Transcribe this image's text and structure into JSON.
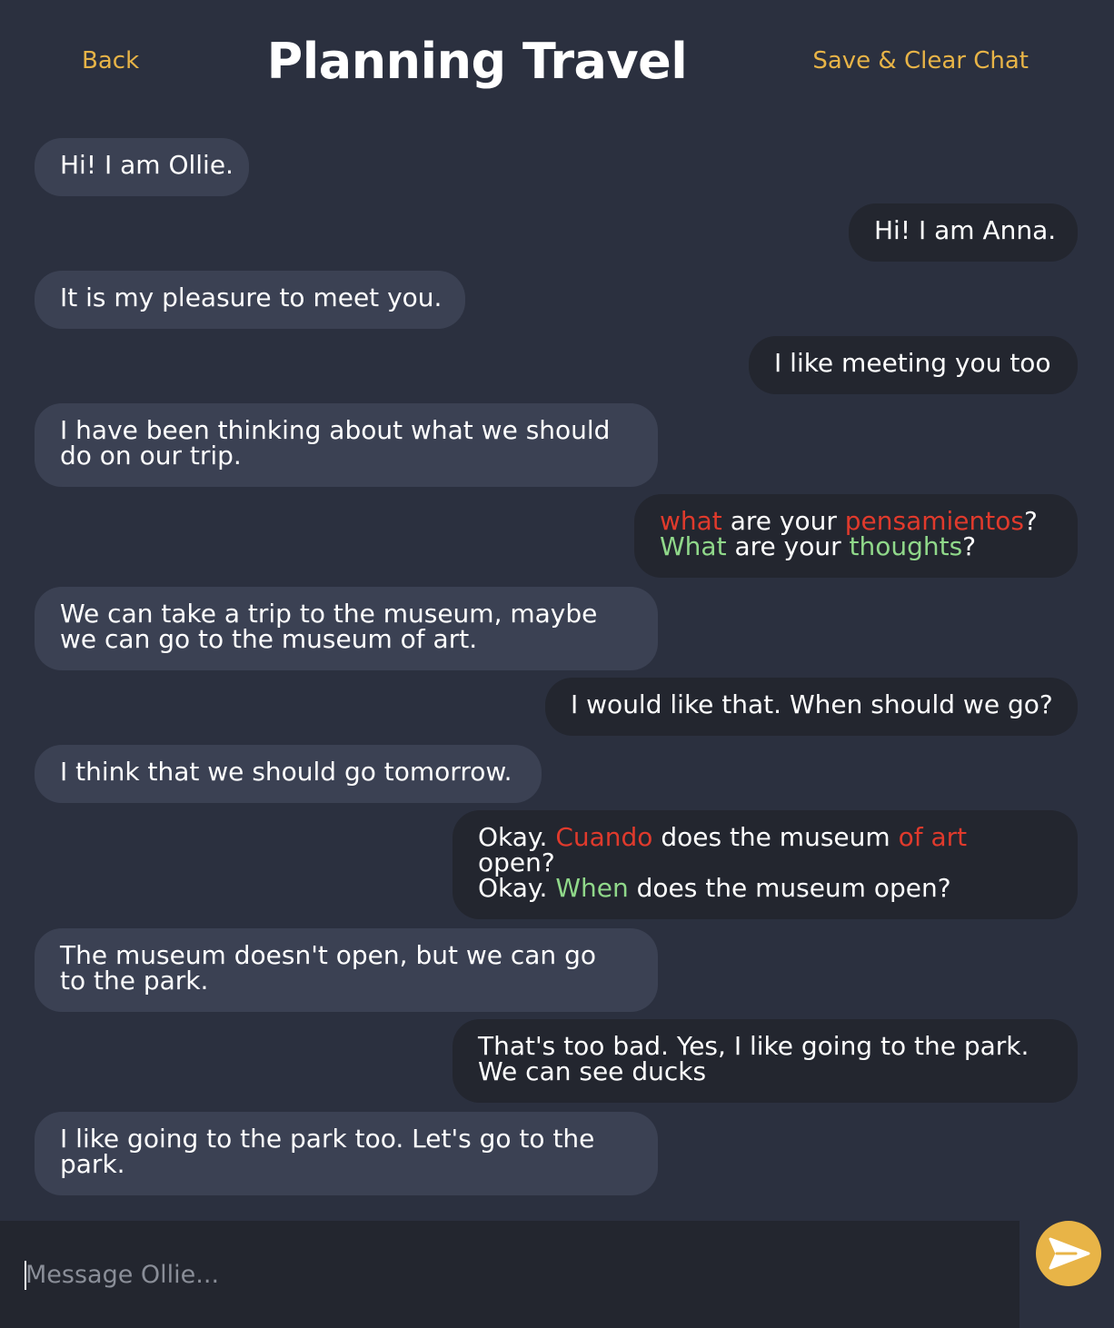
{
  "header": {
    "back_label": "Back",
    "title": "Planning Travel",
    "save_label": "Save & Clear Chat"
  },
  "messages": [
    {
      "sender": "Ollie",
      "text": "Hi! I am Ollie."
    },
    {
      "sender": "Anna",
      "text": "Hi! I am Anna."
    },
    {
      "sender": "Ollie",
      "text": "It is my pleasure to meet you."
    },
    {
      "sender": "Anna",
      "text": "I like meeting you too"
    },
    {
      "sender": "Ollie",
      "line1": "I have been thinking about what we should",
      "line2": "do on our trip."
    },
    {
      "sender": "Anna",
      "original": {
        "w1": "what",
        "t1": " are your ",
        "w2": "pensamientos",
        "t2": "?"
      },
      "correction": {
        "w1": "What",
        "t1": " are your ",
        "w2": "thoughts",
        "t2": "?"
      }
    },
    {
      "sender": "Ollie",
      "line1": "We can take a trip to the museum, maybe",
      "line2": "we can go to the museum of art."
    },
    {
      "sender": "Anna",
      "text": "I would like that. When should we go?"
    },
    {
      "sender": "Ollie",
      "text": "I think that we should go tomorrow."
    },
    {
      "sender": "Anna",
      "original": {
        "t0": "Okay. ",
        "w1": "Cuando",
        "t1": " does the museum ",
        "w2": "of art",
        "t2": "open?"
      },
      "correction": {
        "t0": "Okay. ",
        "w1": "When",
        "t1": " does the museum open?"
      }
    },
    {
      "sender": "Ollie",
      "line1": "The museum doesn't open, but we can go",
      "line2": "to the park."
    },
    {
      "sender": "Anna",
      "line1": "That's too bad. Yes, I like going to the park.",
      "line2": "We can see ducks"
    },
    {
      "sender": "Ollie",
      "line1": "I like going to the park too. Let's go to the",
      "line2": "park."
    }
  ],
  "composer": {
    "placeholder": "Message Ollie...",
    "value": ""
  },
  "send_button": {
    "icon": "send-arrow-icon"
  },
  "colors": {
    "background": "#2b303f",
    "bot_bubble": "#3b4153",
    "user_bubble": "#23262f",
    "accent": "#e8b447",
    "error": "#e03a2c",
    "correction": "#90d88a"
  }
}
